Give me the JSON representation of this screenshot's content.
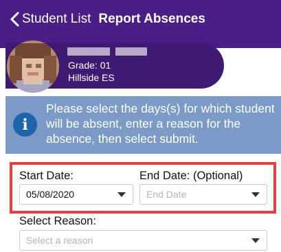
{
  "nav": {
    "back_label": "Student List",
    "title": "Report Absences",
    "color": "#4a1e86"
  },
  "student": {
    "grade": "Grade: 01",
    "school": "Hillside ES"
  },
  "info": {
    "icon": "info-icon",
    "message": "Please select the days(s) for which student will be absent, enter a reason for the absence, then select submit."
  },
  "form": {
    "start_date": {
      "label": "Start Date:",
      "value": "05/08/2020"
    },
    "end_date": {
      "label": "End Date: (Optional)",
      "placeholder": "End Date"
    },
    "reason": {
      "label": "Select Reason:",
      "placeholder": "Select a reason"
    }
  },
  "colors": {
    "header_purple": "#4a1e86",
    "info_banner": "#7b9ac6",
    "info_icon": "#1f63ad",
    "highlight_border": "#ee3b3b"
  }
}
